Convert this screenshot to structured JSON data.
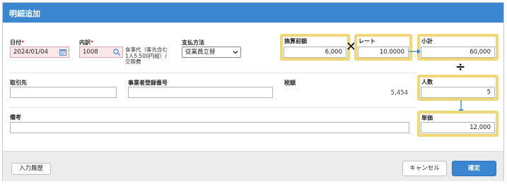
{
  "dialog": {
    "title": "明細追加"
  },
  "fields": {
    "date": {
      "label": "日付",
      "required_mark": "*",
      "value": "2024/01/04"
    },
    "breakdown": {
      "label": "内訳",
      "required_mark": "*",
      "value": "1008",
      "note": "食事代（客先含む1人5,500円超）/交際費"
    },
    "payment": {
      "label": "支払方法",
      "value": "従業員立替"
    },
    "pre_amount": {
      "label": "換算前額",
      "value": "6,000"
    },
    "rate": {
      "label": "レート",
      "value": "10.0000"
    },
    "subtotal": {
      "label": "小計",
      "value": "60,000"
    },
    "partner": {
      "label": "取引先",
      "value": ""
    },
    "registration_no": {
      "label": "事業者登録番号",
      "value": ""
    },
    "tax": {
      "label": "税額",
      "value": "5,454"
    },
    "people": {
      "label": "人数",
      "value": "5"
    },
    "memo": {
      "label": "備考",
      "value": ""
    },
    "unit_price": {
      "label": "単価",
      "value": "12,000"
    }
  },
  "operators": {
    "multiply": "✕",
    "divide": "÷"
  },
  "footer": {
    "history_label": "入力履歴",
    "cancel_label": "キャンセル",
    "confirm_label": "確定"
  },
  "colors": {
    "title_bar": "#3a86d0",
    "highlight": "#f0d779",
    "arrow": "#2f8bd0",
    "required": "#d23a3a",
    "pink_field": "#fde7ea"
  },
  "icons": {
    "date": "calendar-icon",
    "breakdown": "search-icon",
    "payment": "chevron-down-icon"
  }
}
